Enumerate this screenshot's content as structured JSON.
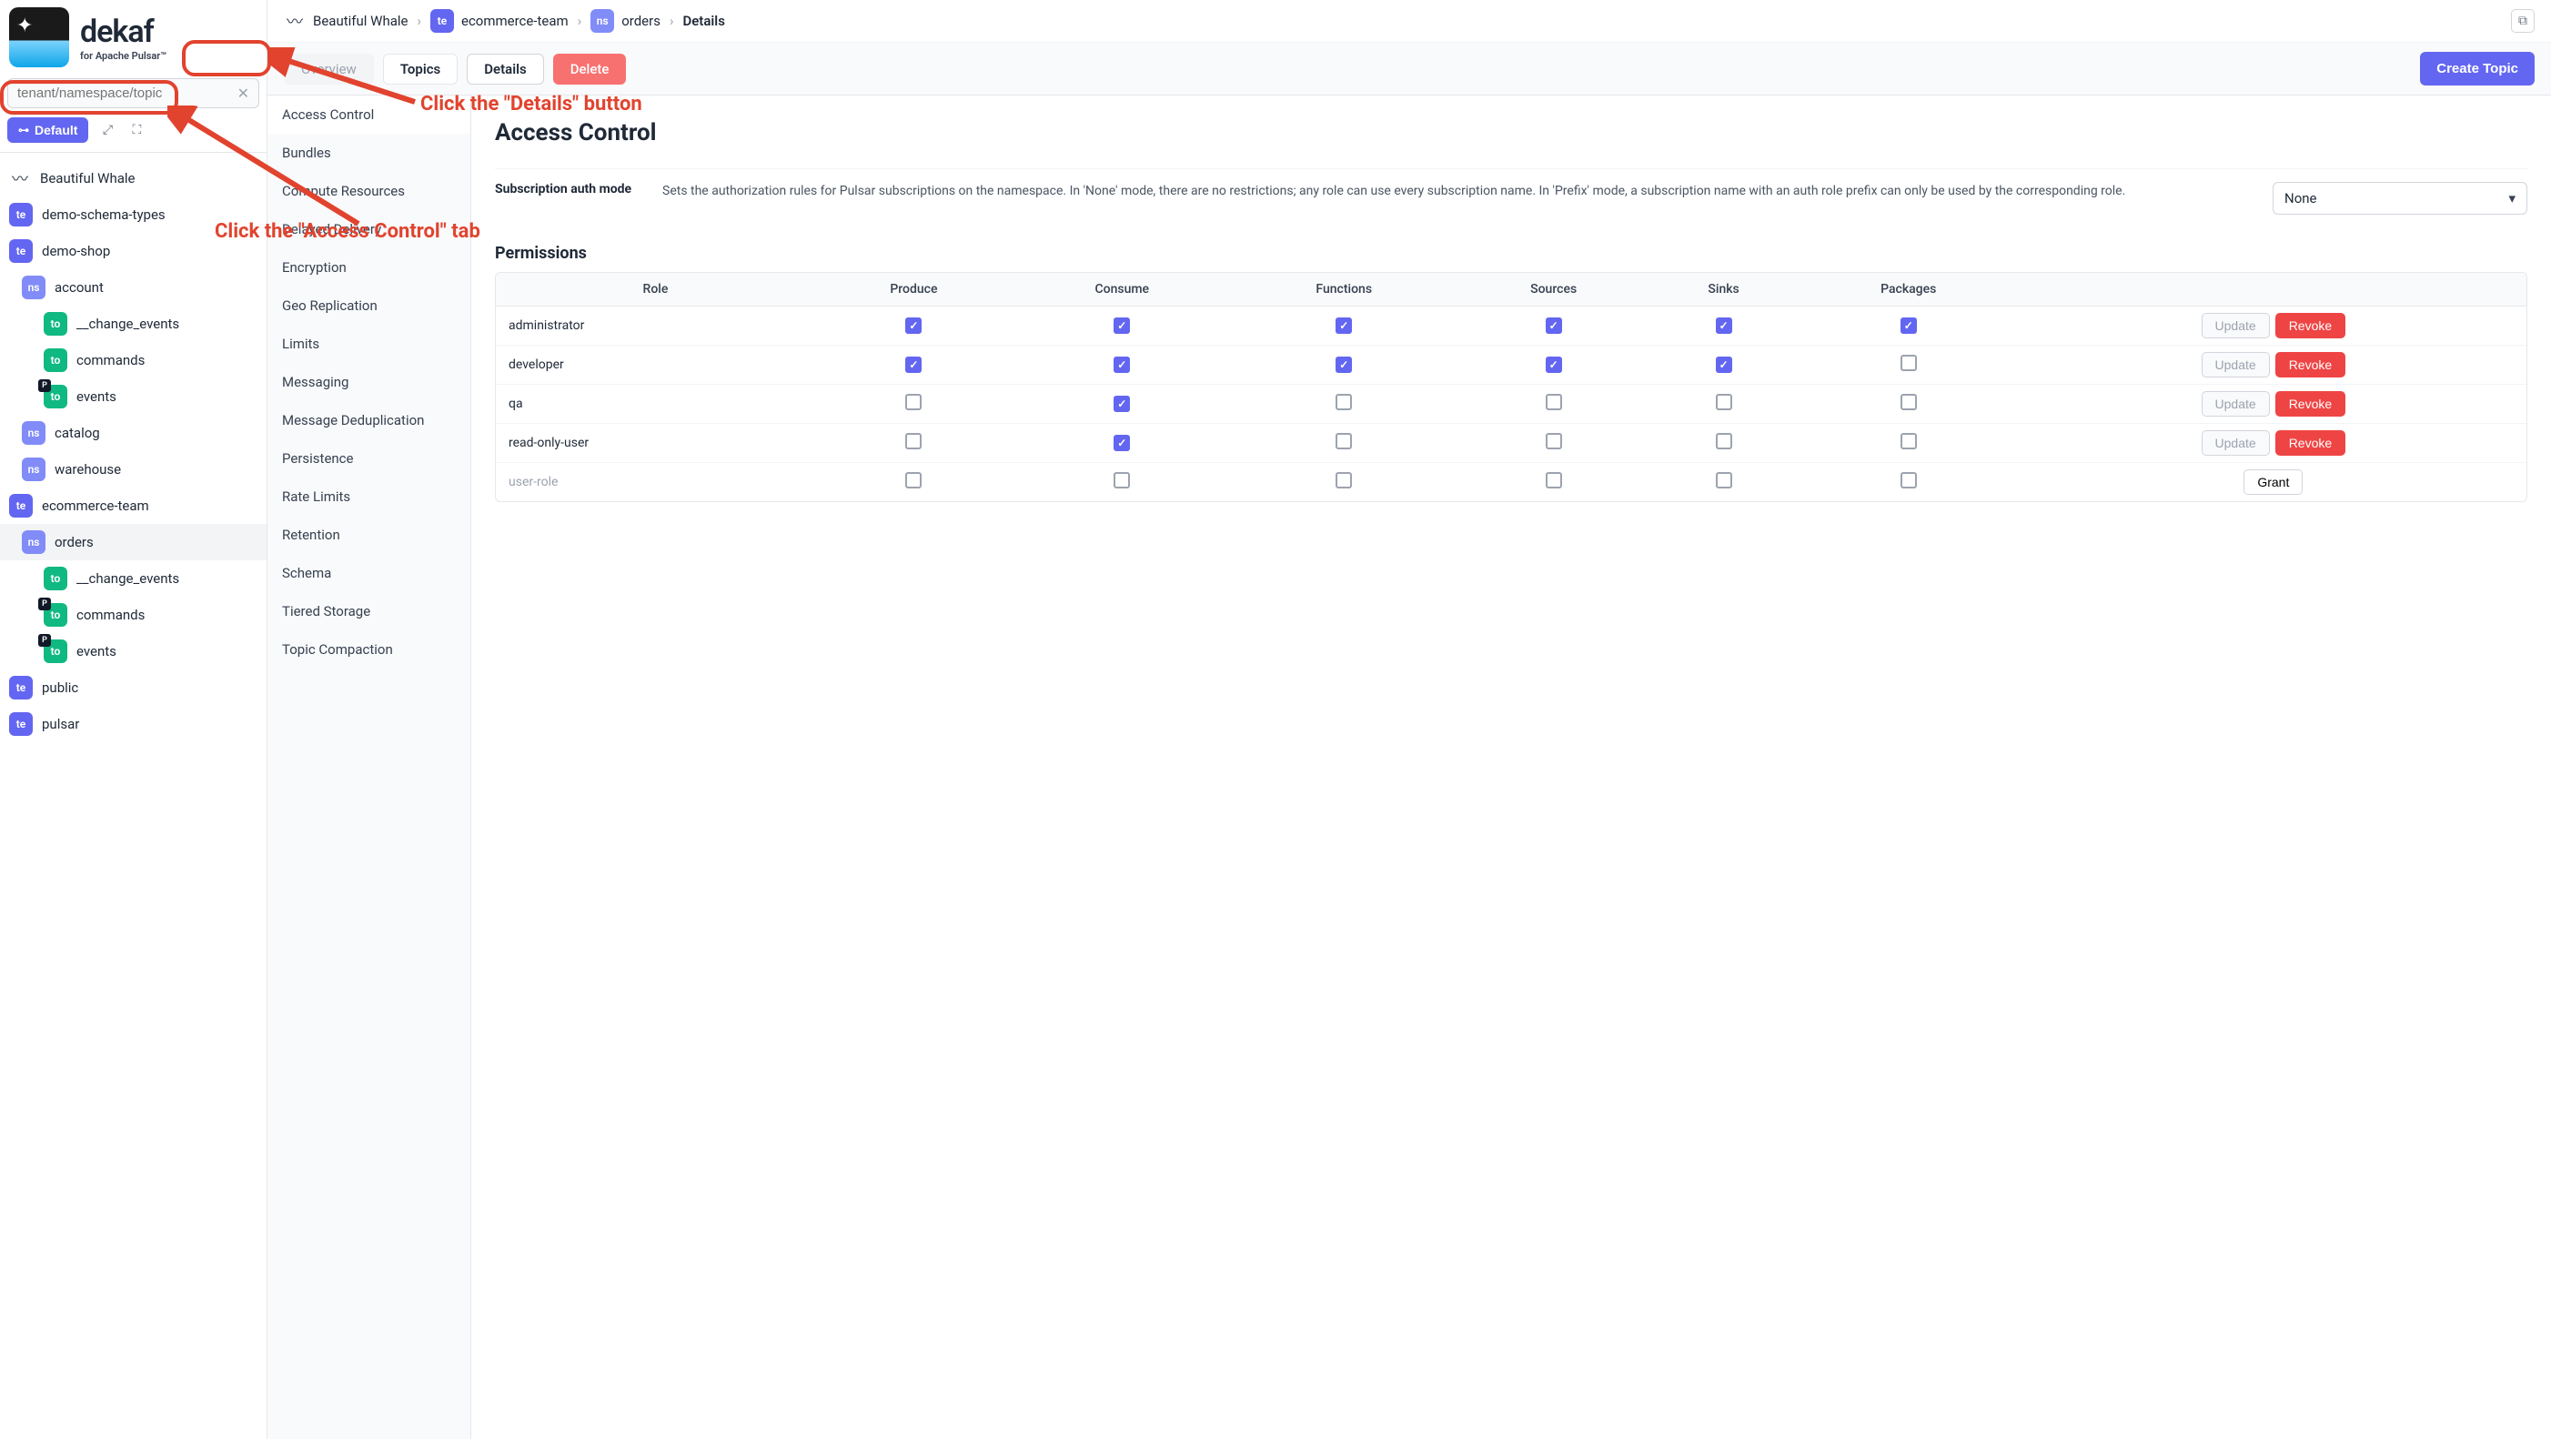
{
  "brand": {
    "name": "dekaf",
    "tagline": "for Apache Pulsar™"
  },
  "search": {
    "placeholder": "tenant/namespace/topic"
  },
  "default_btn": "Default",
  "cluster_name": "Beautiful Whale",
  "tree": [
    {
      "type": "cluster",
      "label": "Beautiful Whale"
    },
    {
      "type": "te",
      "label": "demo-schema-types",
      "indent": 0
    },
    {
      "type": "te",
      "label": "demo-shop",
      "indent": 0
    },
    {
      "type": "ns",
      "label": "account",
      "indent": 1
    },
    {
      "type": "to",
      "label": "__change_events",
      "indent": 2
    },
    {
      "type": "to",
      "label": "commands",
      "indent": 2
    },
    {
      "type": "to",
      "label": "events",
      "indent": 2,
      "dark": true
    },
    {
      "type": "ns",
      "label": "catalog",
      "indent": 1
    },
    {
      "type": "ns",
      "label": "warehouse",
      "indent": 1
    },
    {
      "type": "te",
      "label": "ecommerce-team",
      "indent": 0
    },
    {
      "type": "ns",
      "label": "orders",
      "indent": 1,
      "selected": true
    },
    {
      "type": "to",
      "label": "__change_events",
      "indent": 2
    },
    {
      "type": "to",
      "label": "commands",
      "indent": 2,
      "dark": true
    },
    {
      "type": "to",
      "label": "events",
      "indent": 2,
      "dark": true
    },
    {
      "type": "te",
      "label": "public",
      "indent": 0
    },
    {
      "type": "te",
      "label": "pulsar",
      "indent": 0
    }
  ],
  "breadcrumb": {
    "cluster": "Beautiful Whale",
    "tenant": "ecommerce-team",
    "namespace": "orders",
    "current": "Details"
  },
  "tabs": {
    "overview": "Overview",
    "topics": "Topics",
    "details": "Details",
    "delete": "Delete"
  },
  "create_btn": "Create Topic",
  "section_nav": [
    "Access Control",
    "Bundles",
    "Compute Resources",
    "Delayed Delivery",
    "Encryption",
    "Geo Replication",
    "Limits",
    "Messaging",
    "Message Deduplication",
    "Persistence",
    "Rate Limits",
    "Retention",
    "Schema",
    "Tiered Storage",
    "Topic Compaction"
  ],
  "page_title": "Access Control",
  "sub_auth": {
    "label": "Subscription auth mode",
    "desc": "Sets the authorization rules for Pulsar subscriptions on the namespace. In 'None' mode, there are no restrictions; any role can use every subscription name. In 'Prefix' mode, a subscription name with an auth role prefix can only be used by the corresponding role.",
    "value": "None"
  },
  "permissions_title": "Permissions",
  "perm_headers": [
    "Role",
    "Produce",
    "Consume",
    "Functions",
    "Sources",
    "Sinks",
    "Packages"
  ],
  "perm_rows": [
    {
      "role": "administrator",
      "vals": [
        true,
        true,
        true,
        true,
        true,
        true
      ],
      "actions": [
        "Update",
        "Revoke"
      ]
    },
    {
      "role": "developer",
      "vals": [
        true,
        true,
        true,
        true,
        true,
        false
      ],
      "actions": [
        "Update",
        "Revoke"
      ]
    },
    {
      "role": "qa",
      "vals": [
        false,
        true,
        false,
        false,
        false,
        false
      ],
      "actions": [
        "Update",
        "Revoke"
      ]
    },
    {
      "role": "read-only-user",
      "vals": [
        false,
        true,
        false,
        false,
        false,
        false
      ],
      "actions": [
        "Update",
        "Revoke"
      ]
    },
    {
      "role": "user-role",
      "placeholder": true,
      "vals": [
        false,
        false,
        false,
        false,
        false,
        false
      ],
      "actions": [
        "Grant"
      ]
    }
  ],
  "annotations": {
    "details": "Click the \"Details\" button",
    "access": "Click the \"Access Control\" tab"
  }
}
